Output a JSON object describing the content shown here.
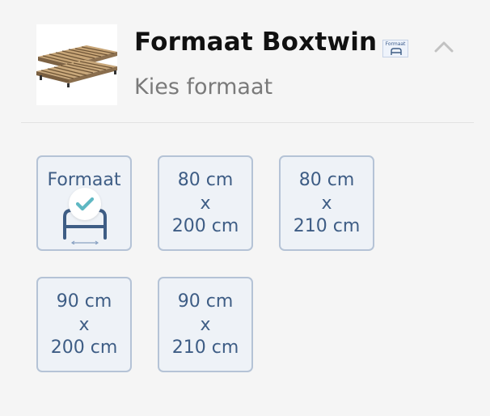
{
  "header": {
    "title": "Formaat Boxtwin",
    "subtitle": "Kies formaat",
    "badge_label": "Formaat",
    "collapse_icon": "chevron-up-icon",
    "thumbnail_alt": "boxspring thumbnail"
  },
  "options": {
    "default": {
      "label": "Formaat",
      "icon": "bed-icon",
      "selected": true,
      "selected_icon": "checkmark-icon"
    },
    "items": [
      {
        "line1": "80 cm",
        "line2": "x",
        "line3": "200 cm",
        "selected": false
      },
      {
        "line1": "80 cm",
        "line2": "x",
        "line3": "210 cm",
        "selected": false
      },
      {
        "line1": "90 cm",
        "line2": "x",
        "line3": "200 cm",
        "selected": false
      },
      {
        "line1": "90 cm",
        "line2": "x",
        "line3": "210 cm",
        "selected": false
      }
    ]
  },
  "colors": {
    "background": "#f5f5f5",
    "option_background": "#eef2f7",
    "option_border": "#b5c3d6",
    "option_text": "#3e5d85",
    "check_color": "#5fb8c3",
    "title_color": "#111111",
    "subtitle_color": "#7a7a7a"
  }
}
